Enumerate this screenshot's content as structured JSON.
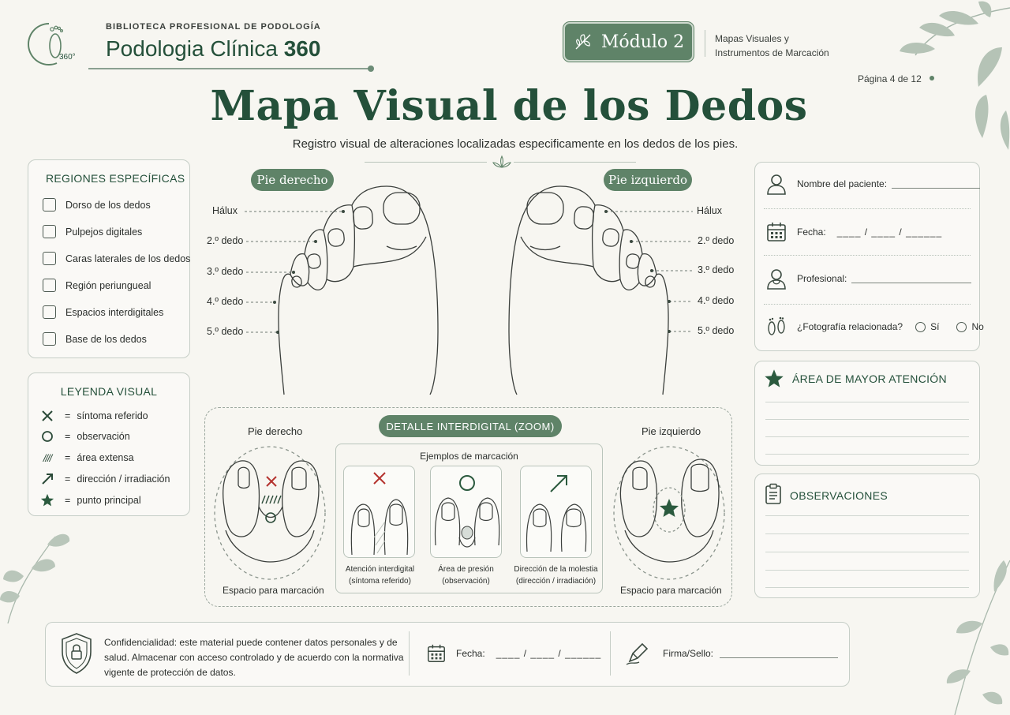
{
  "header": {
    "logo_text": "360°",
    "library_name": "BIBLIOTECA PROFESIONAL DE PODOLOGÍA",
    "brand_name_main": "Podologia Clínica",
    "brand_name_num": "360",
    "module_label": "Módulo 2",
    "module_desc_line1": "Mapas Visuales y",
    "module_desc_line2": "Instrumentos de Marcación",
    "page_indicator": "Página 4 de 12"
  },
  "title": "Mapa Visual de los Dedos",
  "subtitle": "Registro visual de alteraciones localizadas especificamente en los dedos de los pies.",
  "regions": {
    "title": "REGIONES ESPECÍFICAS",
    "items": [
      "Dorso de los dedos",
      "Pulpejos digitales",
      "Caras laterales de los dedos",
      "Región periungueal",
      "Espacios interdigitales",
      "Base de los dedos"
    ]
  },
  "legend": {
    "title": "LEYENDA VISUAL",
    "equals": "=",
    "items": [
      {
        "symbol": "x-mark-icon",
        "label": "síntoma referido"
      },
      {
        "symbol": "circle-icon",
        "label": "observación"
      },
      {
        "symbol": "hatch-icon",
        "label": "área extensa",
        "glyph": "////"
      },
      {
        "symbol": "arrow-icon",
        "label": "dirección / irradiación"
      },
      {
        "symbol": "star-icon",
        "label": "punto principal"
      }
    ]
  },
  "feet": {
    "right_label": "Pie derecho",
    "left_label": "Pie izquierdo",
    "toes": [
      "Hálux",
      "2.º dedo",
      "3.º dedo",
      "4.º dedo",
      "5.º dedo"
    ]
  },
  "zoom": {
    "title": "DETALLE INTERDIGITAL (ZOOM)",
    "right_foot": "Pie derecho",
    "left_foot": "Pie izquierdo",
    "space_label": "Espacio para marcación",
    "examples_title": "Ejemplos de marcación",
    "examples": [
      {
        "line1": "Atención interdigital",
        "line2": "(síntoma referido)"
      },
      {
        "line1": "Área de presión",
        "line2": "(observación)"
      },
      {
        "line1": "Dirección de la molestia",
        "line2": "(dirección / irradiación)"
      }
    ]
  },
  "patient": {
    "name_label": "Nombre del paciente:",
    "date_label": "Fecha:",
    "date_blank": "____ / ____ / ______",
    "professional_label": "Profesional:",
    "photo_label": "¿Fotografía relacionada?",
    "yes": "Sí",
    "no": "No"
  },
  "attention": {
    "title": "ÁREA DE MAYOR ATENCIÓN"
  },
  "observations": {
    "title": "OBSERVACIONES"
  },
  "footer": {
    "confidentiality": "Confidencialidad: este material puede contener datos personales y de salud. Almacenar con acceso controlado y de acuerdo con la normativa vigente de protección de datos.",
    "date_label": "Fecha:",
    "date_blank": "____ / ____ / ______",
    "signature_label": "Firma/Sello:"
  },
  "colors": {
    "brand_green": "#24503a",
    "accent_green": "#5f8368",
    "mark_red": "#b4322e",
    "background": "#f7f6f1"
  }
}
